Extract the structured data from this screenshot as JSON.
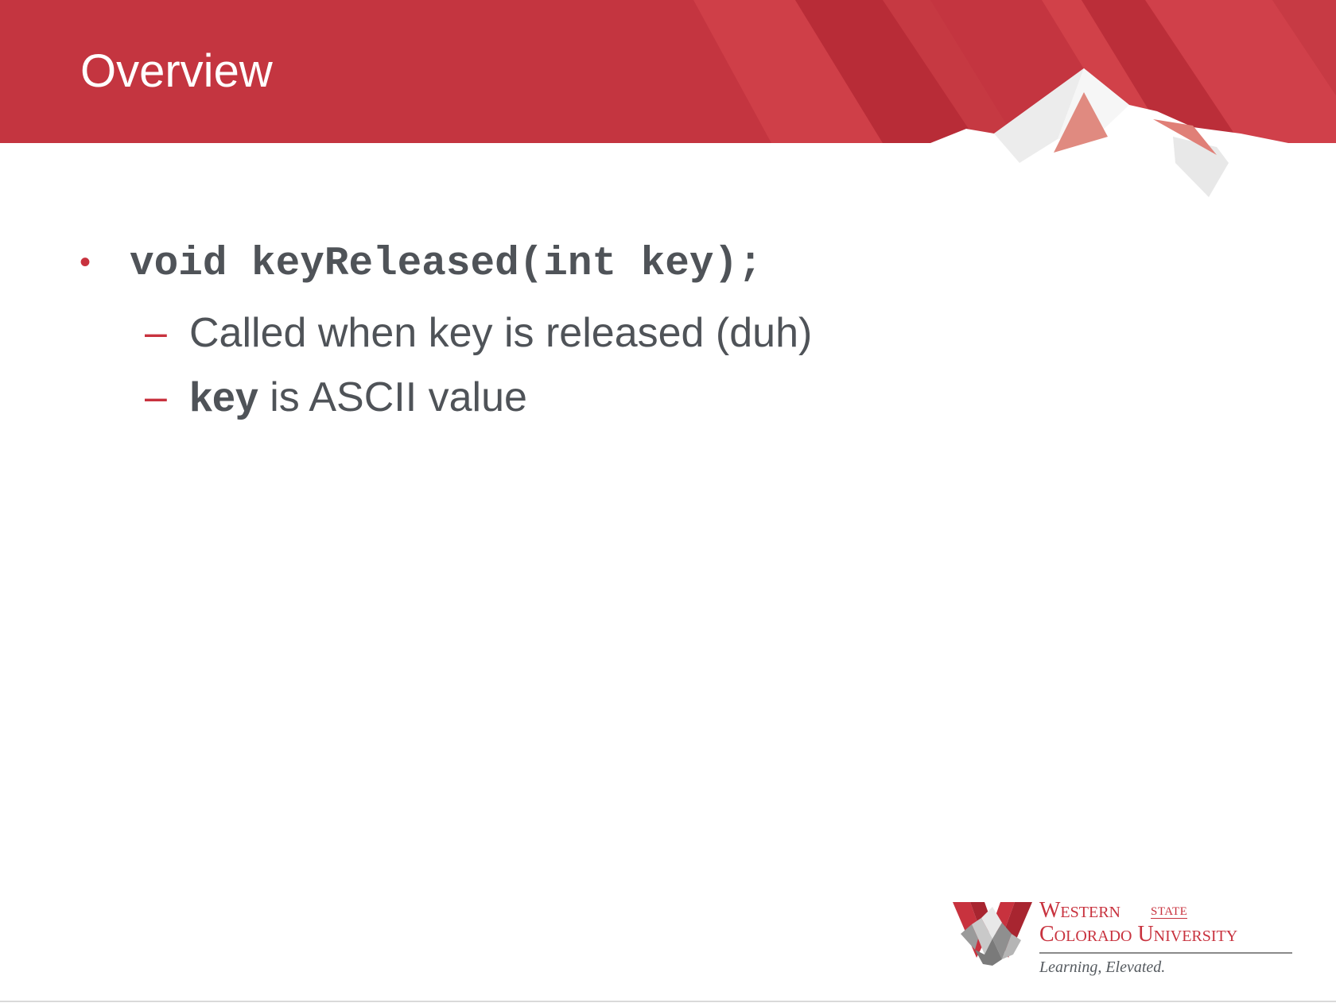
{
  "slide": {
    "title": "Overview",
    "bullets": [
      {
        "code": "void keyReleased(int key);",
        "subitems": [
          {
            "bold": "",
            "text": "Called when key is released (duh)"
          },
          {
            "bold": "key",
            "text": " is ASCII value"
          }
        ]
      }
    ]
  },
  "logo": {
    "line1": "Western",
    "state": "STATE",
    "line2": "Colorado University",
    "tagline": "Learning, Elevated."
  },
  "colors": {
    "accent": "#c8323e",
    "banner": "#c43540",
    "text": "#4f5358"
  }
}
